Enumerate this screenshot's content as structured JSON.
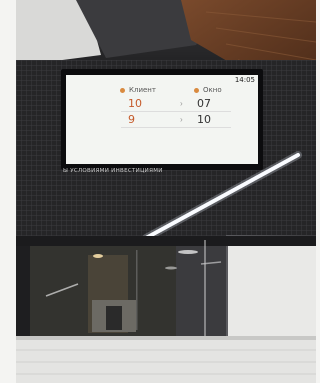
{
  "scene": {
    "tv": {
      "clock": "14:05",
      "headers": {
        "client": "Клиент",
        "window": "Окно"
      },
      "rows": [
        {
          "client": "10",
          "window": "07"
        },
        {
          "client": "9",
          "window": "10"
        }
      ],
      "arrow": "›",
      "ticker": "Ы УСЛОВИЯМИ ИНВЕСТИЦИЯМИ"
    },
    "colors": {
      "dot_accent": "#d98a3f",
      "client_number": "#c55a2a",
      "screen_bg": "#f3f5f2"
    }
  }
}
